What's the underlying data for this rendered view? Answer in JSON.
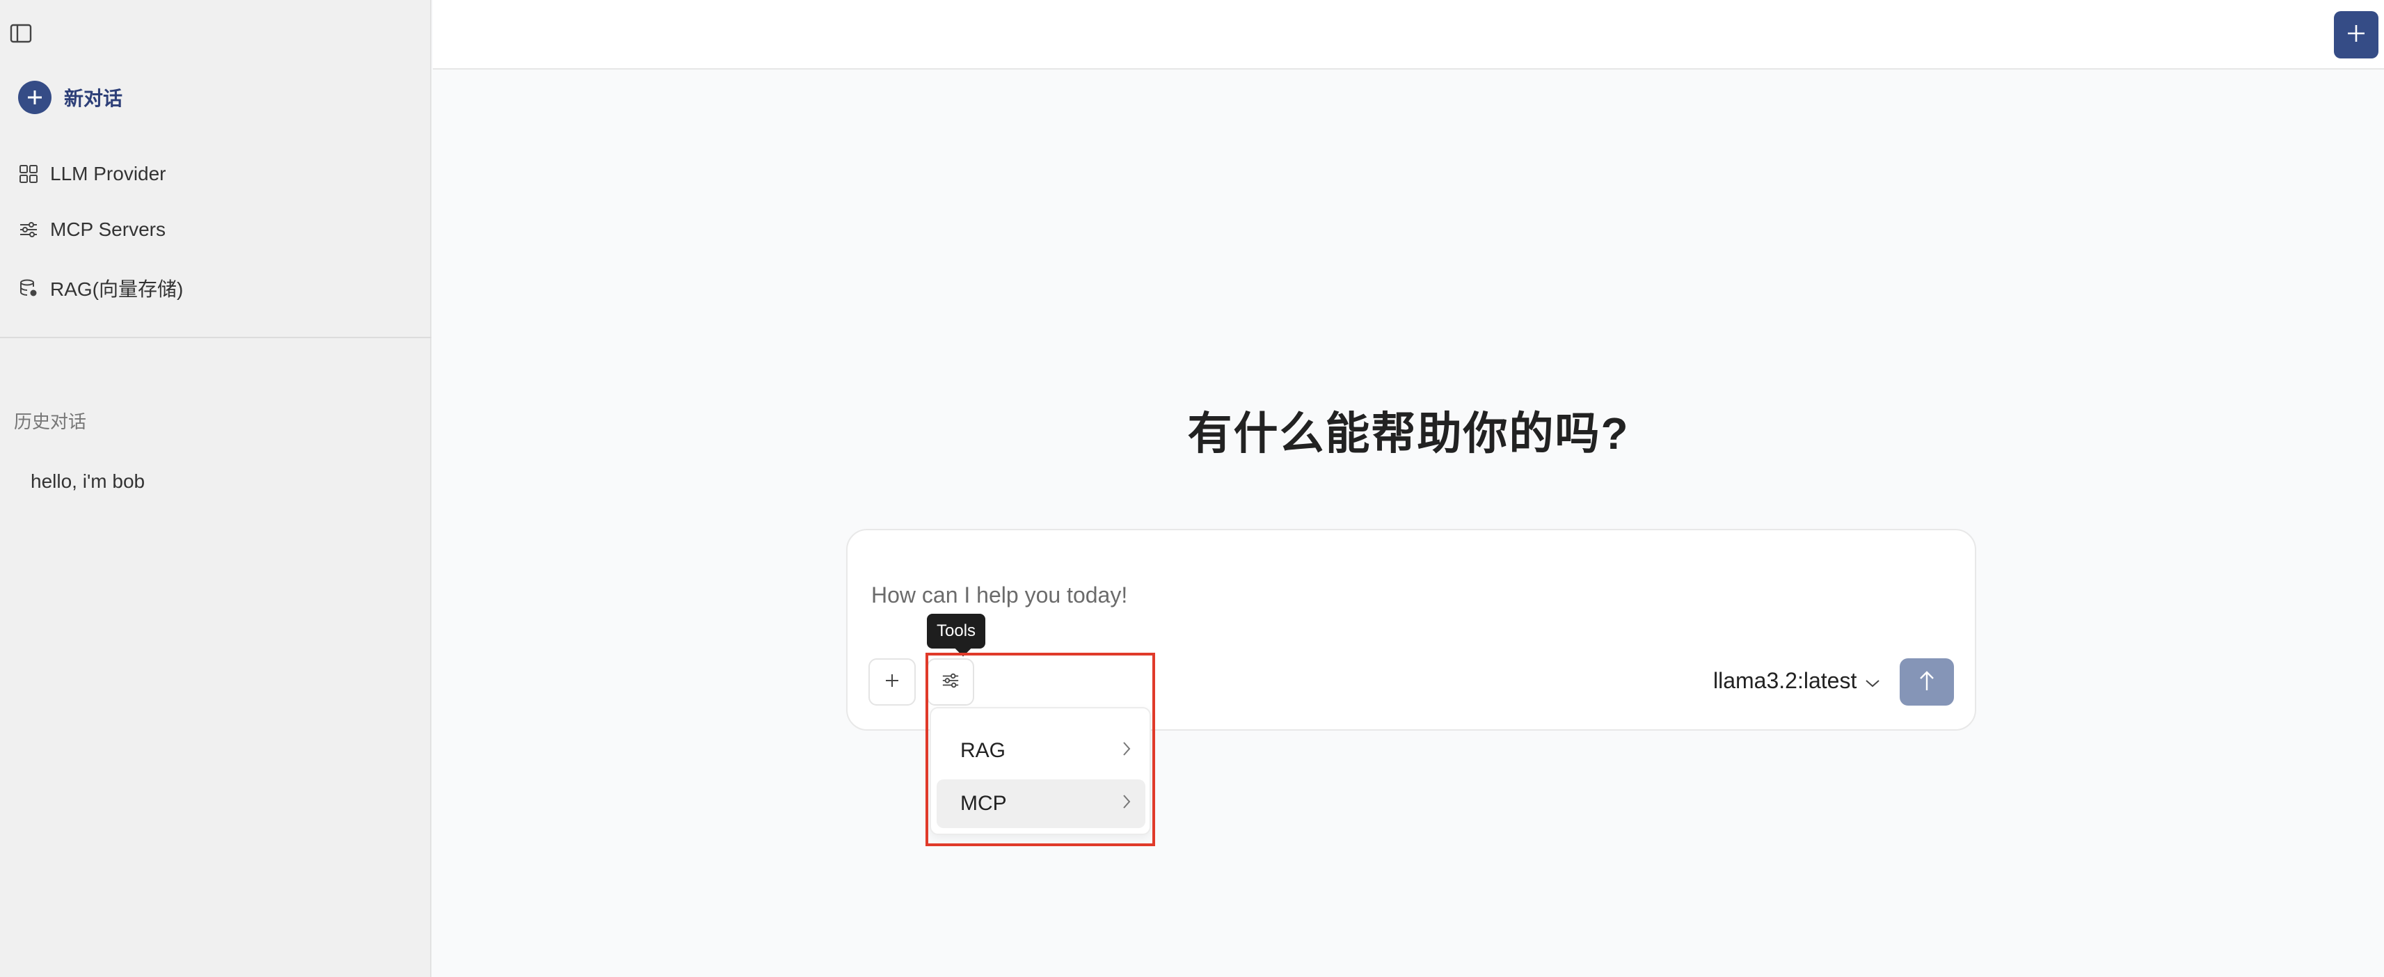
{
  "sidebar": {
    "new_chat_label": "新对话",
    "nav": [
      {
        "label": "LLM Provider",
        "icon": "grid-icon"
      },
      {
        "label": "MCP Servers",
        "icon": "sliders-icon"
      },
      {
        "label": "RAG(向量存储)",
        "icon": "database-icon"
      }
    ],
    "history_heading": "历史对话",
    "history": [
      {
        "label": "hello, i'm bob"
      }
    ]
  },
  "main": {
    "greeting": "有什么能帮助你的吗?",
    "composer": {
      "placeholder": "How can I help you today!",
      "tools_tooltip": "Tools",
      "model": "llama3.2:latest"
    },
    "tools_menu": [
      {
        "label": "RAG",
        "active": false
      },
      {
        "label": "MCP",
        "active": true
      }
    ]
  },
  "colors": {
    "accent": "#354c86",
    "send_button": "#8595b7",
    "highlight": "#e03a2a",
    "sidebar_bg": "#f0f0f0"
  }
}
